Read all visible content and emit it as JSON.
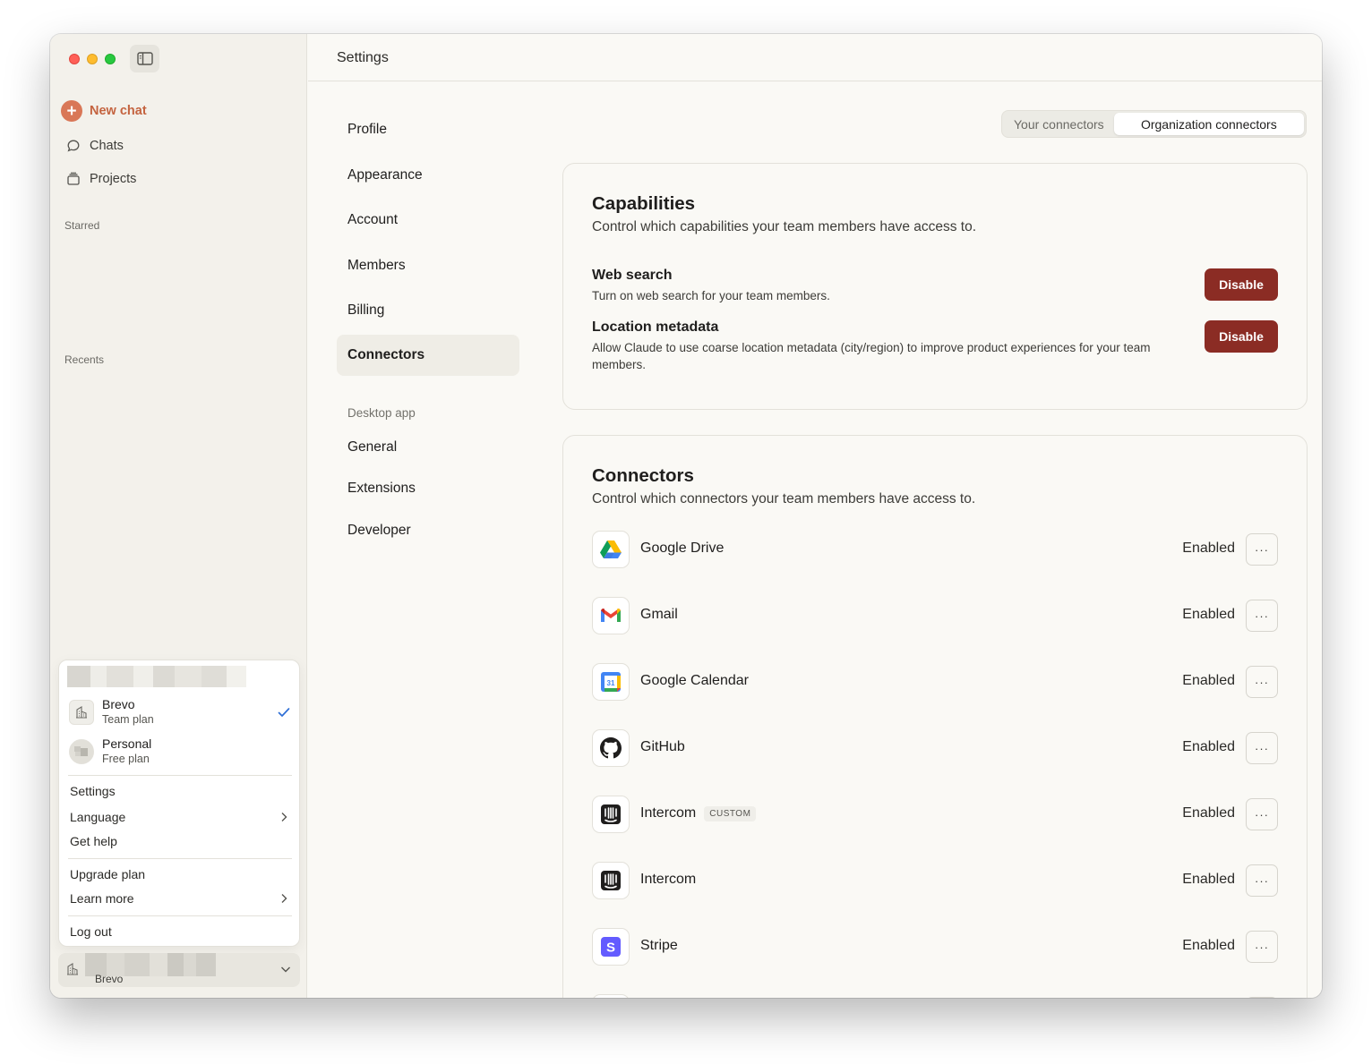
{
  "sidebar": {
    "new_chat": "New chat",
    "chats": "Chats",
    "projects": "Projects",
    "starred": "Starred",
    "recents": "Recents"
  },
  "account_menu": {
    "orgs": [
      {
        "name": "Brevo",
        "plan": "Team plan",
        "selected": true
      },
      {
        "name": "Personal",
        "plan": "Free plan",
        "selected": false
      }
    ],
    "items": {
      "settings": "Settings",
      "language": "Language",
      "get_help": "Get help",
      "upgrade_plan": "Upgrade plan",
      "learn_more": "Learn more",
      "log_out": "Log out"
    }
  },
  "account_bar": {
    "org": "Brevo"
  },
  "header": {
    "title": "Settings"
  },
  "settings_nav": {
    "items": [
      "Profile",
      "Appearance",
      "Account",
      "Members",
      "Billing",
      "Connectors"
    ],
    "active": "Connectors",
    "desktop_section": "Desktop app",
    "desktop_items": [
      "General",
      "Extensions",
      "Developer"
    ]
  },
  "tabs": {
    "your": "Your connectors",
    "org": "Organization connectors",
    "active": "Organization connectors"
  },
  "capabilities": {
    "title": "Capabilities",
    "subtitle": "Control which capabilities your team members have access to.",
    "items": [
      {
        "name": "Web search",
        "desc": "Turn on web search for your team members.",
        "button": "Disable"
      },
      {
        "name": "Location metadata",
        "desc": "Allow Claude to use coarse location metadata (city/region) to improve product experiences for your team members.",
        "button": "Disable"
      }
    ]
  },
  "connectors": {
    "title": "Connectors",
    "subtitle": "Control which connectors your team members have access to.",
    "more_label": "···",
    "items": [
      {
        "name": "Google Drive",
        "status": "Enabled",
        "icon": "google-drive-icon",
        "badge": ""
      },
      {
        "name": "Gmail",
        "status": "Enabled",
        "icon": "gmail-icon",
        "badge": ""
      },
      {
        "name": "Google Calendar",
        "status": "Enabled",
        "icon": "google-calendar-icon",
        "badge": "",
        "icon_text": "31"
      },
      {
        "name": "GitHub",
        "status": "Enabled",
        "icon": "github-icon",
        "badge": ""
      },
      {
        "name": "Intercom",
        "status": "Enabled",
        "icon": "intercom-icon",
        "badge": "CUSTOM"
      },
      {
        "name": "Intercom",
        "status": "Enabled",
        "icon": "intercom-icon",
        "badge": ""
      },
      {
        "name": "Stripe",
        "status": "Enabled",
        "icon": "stripe-icon",
        "badge": "",
        "icon_text": "S"
      }
    ]
  },
  "colors": {
    "accent": "#d97757",
    "disable_button": "#8b2c24",
    "background": "#faf9f5",
    "sidebar": "#f3f1eb"
  }
}
